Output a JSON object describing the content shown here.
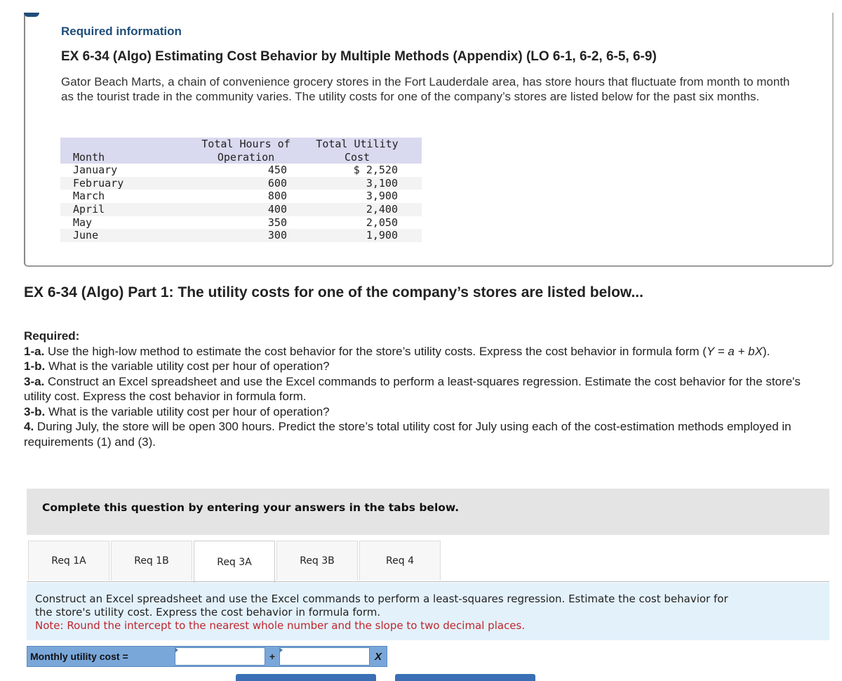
{
  "header": {
    "required_info": "Required information",
    "title": "EX 6-34 (Algo) Estimating Cost Behavior by Multiple Methods (Appendix) (LO 6-1, 6-2, 6-5, 6-9)",
    "intro": "Gator Beach Marts, a chain of convenience grocery stores in the Fort Lauderdale area, has store hours that fluctuate from month to month as the tourist trade in the community varies. The utility costs for one of the company’s stores are listed below for the past six months."
  },
  "table": {
    "headers": {
      "month": "Month",
      "hours_line1": "Total Hours of",
      "hours_line2": "Operation",
      "cost_line1": "Total Utility",
      "cost_line2": "Cost"
    },
    "rows": [
      {
        "month": "January",
        "hours": "450",
        "cost": "$ 2,520"
      },
      {
        "month": "February",
        "hours": "600",
        "cost": "3,100"
      },
      {
        "month": "March",
        "hours": "800",
        "cost": "3,900"
      },
      {
        "month": "April",
        "hours": "400",
        "cost": "2,400"
      },
      {
        "month": "May",
        "hours": "350",
        "cost": "2,050"
      },
      {
        "month": "June",
        "hours": "300",
        "cost": "1,900"
      }
    ]
  },
  "part_title": "EX 6-34 (Algo) Part 1: The utility costs for one of the company’s stores are listed below...",
  "required": {
    "heading": "Required:",
    "items": [
      {
        "label": "1-a.",
        "text": " Use the high-low method to estimate the cost behavior for the store’s utility costs. Express the cost behavior in formula form (",
        "formula": "Y = a + bX",
        "after": ")."
      },
      {
        "label": "1-b.",
        "text": " What is the variable utility cost per hour of operation?"
      },
      {
        "label": "3-a.",
        "text": " Construct an Excel spreadsheet and use the Excel commands to perform a least-squares regression. Estimate the cost behavior for the store's utility cost. Express the cost behavior in formula form."
      },
      {
        "label": "3-b.",
        "text": " What is the variable utility cost per hour of operation?"
      },
      {
        "label": "4.",
        "text": " During July, the store will be open 300 hours. Predict the store’s total utility cost for July using each of the cost-estimation methods employed in requirements (1) and (3)."
      }
    ]
  },
  "complete_prompt": "Complete this question by entering your answers in the tabs below.",
  "tabs": [
    {
      "label": "Req 1A",
      "active": false
    },
    {
      "label": "Req 1B",
      "active": false
    },
    {
      "label": "Req 3A",
      "active": true
    },
    {
      "label": "Req 3B",
      "active": false
    },
    {
      "label": "Req 4",
      "active": false
    }
  ],
  "instructions": {
    "text": "Construct an Excel spreadsheet and use the Excel commands to perform a least-squares regression. Estimate the cost behavior for the store's utility cost. Express the cost behavior in formula form.",
    "note": "Note: Round the intercept to the nearest whole number and the slope to two decimal places."
  },
  "formula": {
    "label": "Monthly utility cost =",
    "intercept_value": "",
    "plus": "+",
    "slope_value": "",
    "variable": "X"
  }
}
